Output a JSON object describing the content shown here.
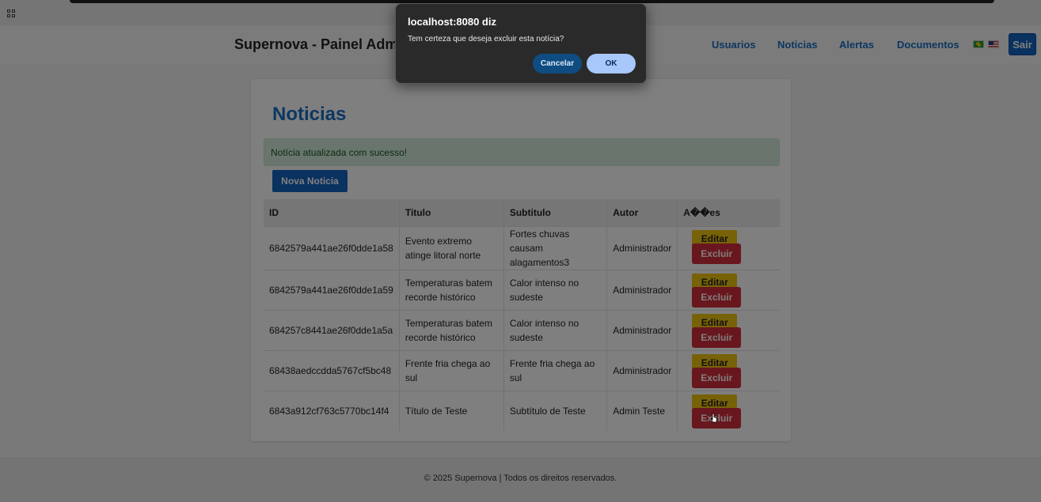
{
  "header": {
    "brand": "Supernova - Painel Administrativo",
    "nav": [
      "Usuarios",
      "Noticias",
      "Alertas",
      "Documentos"
    ],
    "logout_label": "Sair"
  },
  "main": {
    "title": "Noticias",
    "success_message": "Notícia atualizada com sucesso!",
    "new_button": "Nova Noticia",
    "table": {
      "headers": [
        "ID",
        "Titulo",
        "Subtitulo",
        "Autor",
        "A��es"
      ],
      "rows": [
        {
          "id": "6842579a441ae26f0dde1a58",
          "titulo": "Evento extremo atinge litoral norte",
          "subtitulo": "Fortes chuvas causam alagamentos3",
          "autor": "Administrador"
        },
        {
          "id": "6842579a441ae26f0dde1a59",
          "titulo": "Temperaturas batem recorde histórico",
          "subtitulo": "Calor intenso no sudeste",
          "autor": "Administrador"
        },
        {
          "id": "684257c8441ae26f0dde1a5a",
          "titulo": "Temperaturas batem recorde histórico",
          "subtitulo": "Calor intenso no sudeste",
          "autor": "Administrador"
        },
        {
          "id": "68438aedccdda5767cf5bc48",
          "titulo": "Frente fria chega ao sul",
          "subtitulo": "Frente fria chega ao sul",
          "autor": "Administrador"
        },
        {
          "id": "6843a912cf763c5770bc14f4",
          "titulo": "Título de Teste",
          "subtitulo": "Subtítulo de Teste",
          "autor": "Admin Teste"
        }
      ],
      "edit_label": "Editar",
      "delete_label": "Excluir"
    }
  },
  "footer": {
    "text": "© 2025 Supernova | Todos os direitos reservados."
  },
  "dialog": {
    "title": "localhost:8080 diz",
    "message": "Tem certeza que deseja excluir esta notícia?",
    "cancel_label": "Cancelar",
    "ok_label": "OK"
  },
  "colors": {
    "primary": "#1565c0",
    "link": "#1a6fc2",
    "edit": "#f1c40f",
    "delete": "#d32f3d",
    "success_bg": "#d4edda"
  }
}
